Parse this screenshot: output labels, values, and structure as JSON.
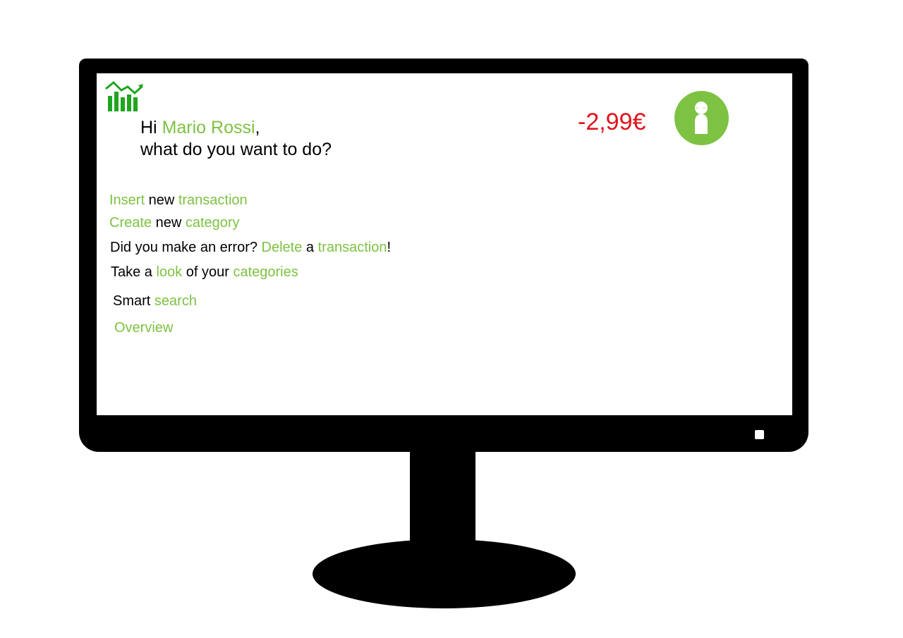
{
  "header": {
    "greeting_prefix": "Hi ",
    "user_name": "Mario Rossi",
    "greeting_comma": ",",
    "question": "what do you want to do?",
    "balance": "-2,99€"
  },
  "menu": {
    "insert_transaction": {
      "w1": "Insert",
      "w2": " new ",
      "w3": "transaction"
    },
    "create_category": {
      "w1": "Create",
      "w2": " new ",
      "w3": "category"
    },
    "delete_transaction": {
      "w1": "Did you make an error? ",
      "w2": "Delete",
      "w3": " a ",
      "w4": "transaction",
      "w5": "!"
    },
    "view_categories": {
      "w1": "Take a ",
      "w2": "look",
      "w3": " of your ",
      "w4": "categories"
    },
    "smart_search": {
      "w1": "Smart ",
      "w2": "search"
    },
    "overview": {
      "w1": "Overview"
    }
  },
  "icons": {
    "logo": "bar-chart-growth-icon",
    "avatar": "user-avatar-icon"
  },
  "colors": {
    "accent": "#7dc242",
    "logo": "#1fa51f",
    "negative": "#e0141e"
  }
}
